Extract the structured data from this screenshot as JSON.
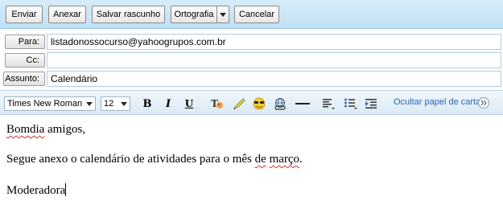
{
  "toolbar": {
    "send_label": "Enviar",
    "attach_label": "Anexar",
    "save_draft_label": "Salvar rascunho",
    "spelling_label": "Ortografia",
    "cancel_label": "Cancelar"
  },
  "header": {
    "to_label": "Para:",
    "to_value": "listadonossocurso@yahoogrupos.com.br",
    "cc_label": "Cc:",
    "cc_value": "",
    "subject_label": "Assunto:",
    "subject_value": "Calendário"
  },
  "format": {
    "font_family": "Times New Roman",
    "font_size": "12",
    "bold_label": "B",
    "italic_label": "I",
    "underline_label": "U",
    "stationery_link": "Ocultar papel de carta"
  },
  "message": {
    "line1_word1": "Bom",
    "line1_word2": "dia",
    "line1_rest": " amigos,",
    "line2_start": "Segue anexo o calendário de atividades para o mês ",
    "line2_de": "de",
    "line2_space": " ",
    "line2_marco": "março",
    "line2_end": ".",
    "line3": "Moderadora"
  },
  "colors": {
    "toolbar_bg": "#bfe0f4",
    "link": "#2a64b0",
    "spellcheck": "#d0302c"
  }
}
